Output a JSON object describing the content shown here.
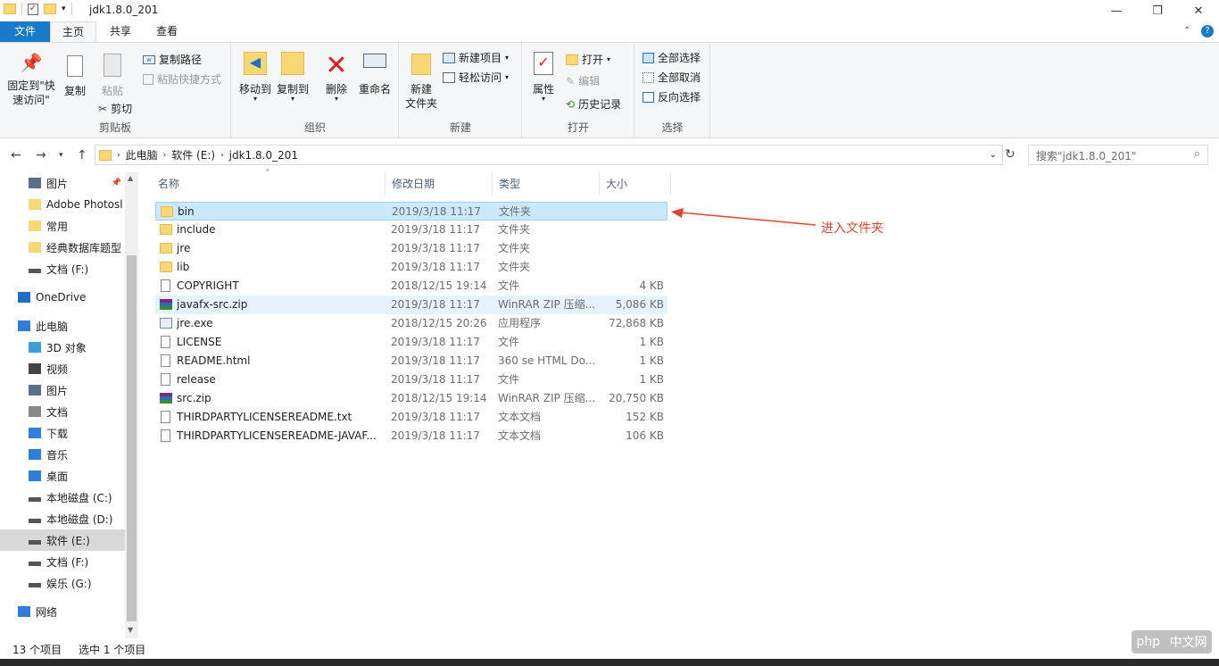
{
  "window": {
    "title": "jdk1.8.0_201"
  },
  "tabs": {
    "file": "文件",
    "home": "主页",
    "share": "共享",
    "view": "查看"
  },
  "ribbon": {
    "clipboard": {
      "pin": "固定到\"快\n速访问\"",
      "copy": "复制",
      "paste": "粘贴",
      "copy_path": "复制路径",
      "paste_shortcut": "粘贴快捷方式",
      "cut": "剪切",
      "label": "剪贴板"
    },
    "organize": {
      "move_to": "移动到",
      "copy_to": "复制到",
      "delete": "删除",
      "rename": "重命名",
      "label": "组织"
    },
    "new": {
      "new_folder": "新建\n文件夹",
      "new_item": "新建项目",
      "easy_access": "轻松访问",
      "label": "新建"
    },
    "open": {
      "properties": "属性",
      "open": "打开",
      "edit": "编辑",
      "history": "历史记录",
      "label": "打开"
    },
    "select": {
      "select_all": "全部选择",
      "select_none": "全部取消",
      "invert": "反向选择",
      "label": "选择"
    }
  },
  "address": {
    "crumbs": [
      "此电脑",
      "软件 (E:)",
      "jdk1.8.0_201"
    ],
    "search_placeholder": "搜索\"jdk1.8.0_201\""
  },
  "nav": [
    {
      "label": "图片",
      "icon": "pictures-icon"
    },
    {
      "label": "Adobe Photosl",
      "icon": "folder-icon"
    },
    {
      "label": "常用",
      "icon": "folder-icon"
    },
    {
      "label": "经典数据库题型",
      "icon": "folder-icon"
    },
    {
      "label": "文档 (F:)",
      "icon": "drive-icon"
    },
    {
      "label": "OneDrive",
      "icon": "cloud-icon"
    },
    {
      "label": "此电脑",
      "icon": "computer-icon"
    },
    {
      "label": "3D 对象",
      "icon": "cube-icon"
    },
    {
      "label": "视频",
      "icon": "video-icon"
    },
    {
      "label": "图片",
      "icon": "pictures-icon"
    },
    {
      "label": "文档",
      "icon": "documents-icon"
    },
    {
      "label": "下载",
      "icon": "download-icon"
    },
    {
      "label": "音乐",
      "icon": "music-icon"
    },
    {
      "label": "桌面",
      "icon": "desktop-icon"
    },
    {
      "label": "本地磁盘 (C:)",
      "icon": "system-drive-icon"
    },
    {
      "label": "本地磁盘 (D:)",
      "icon": "drive-icon"
    },
    {
      "label": "软件 (E:)",
      "icon": "drive-icon"
    },
    {
      "label": "文档 (F:)",
      "icon": "drive-icon"
    },
    {
      "label": "娱乐 (G:)",
      "icon": "drive-icon"
    },
    {
      "label": "网络",
      "icon": "network-icon"
    }
  ],
  "columns": {
    "name": "名称",
    "date": "修改日期",
    "type": "类型",
    "size": "大小"
  },
  "files": [
    {
      "name": "bin",
      "date": "2019/3/18 11:17",
      "type": "文件夹",
      "size": "",
      "kind": "folder"
    },
    {
      "name": "include",
      "date": "2019/3/18 11:17",
      "type": "文件夹",
      "size": "",
      "kind": "folder"
    },
    {
      "name": "jre",
      "date": "2019/3/18 11:17",
      "type": "文件夹",
      "size": "",
      "kind": "folder"
    },
    {
      "name": "lib",
      "date": "2019/3/18 11:17",
      "type": "文件夹",
      "size": "",
      "kind": "folder"
    },
    {
      "name": "COPYRIGHT",
      "date": "2018/12/15 19:14",
      "type": "文件",
      "size": "4 KB",
      "kind": "doc"
    },
    {
      "name": "javafx-src.zip",
      "date": "2019/3/18 11:17",
      "type": "WinRAR ZIP 压缩...",
      "size": "5,086 KB",
      "kind": "zip"
    },
    {
      "name": "jre.exe",
      "date": "2018/12/15 20:26",
      "type": "应用程序",
      "size": "72,868 KB",
      "kind": "exe"
    },
    {
      "name": "LICENSE",
      "date": "2019/3/18 11:17",
      "type": "文件",
      "size": "1 KB",
      "kind": "doc"
    },
    {
      "name": "README.html",
      "date": "2019/3/18 11:17",
      "type": "360 se HTML Do...",
      "size": "1 KB",
      "kind": "html"
    },
    {
      "name": "release",
      "date": "2019/3/18 11:17",
      "type": "文件",
      "size": "1 KB",
      "kind": "doc"
    },
    {
      "name": "src.zip",
      "date": "2018/12/15 19:14",
      "type": "WinRAR ZIP 压缩...",
      "size": "20,750 KB",
      "kind": "zip"
    },
    {
      "name": "THIRDPARTYLICENSEREADME.txt",
      "date": "2019/3/18 11:17",
      "type": "文本文档",
      "size": "152 KB",
      "kind": "doc"
    },
    {
      "name": "THIRDPARTYLICENSEREADME-JAVAF...",
      "date": "2019/3/18 11:17",
      "type": "文本文档",
      "size": "106 KB",
      "kind": "doc"
    }
  ],
  "annotation": "进入文件夹",
  "status": {
    "count": "13 个项目",
    "selected": "选中 1 个项目"
  },
  "watermark": {
    "left": "php",
    "right": "中文网"
  }
}
